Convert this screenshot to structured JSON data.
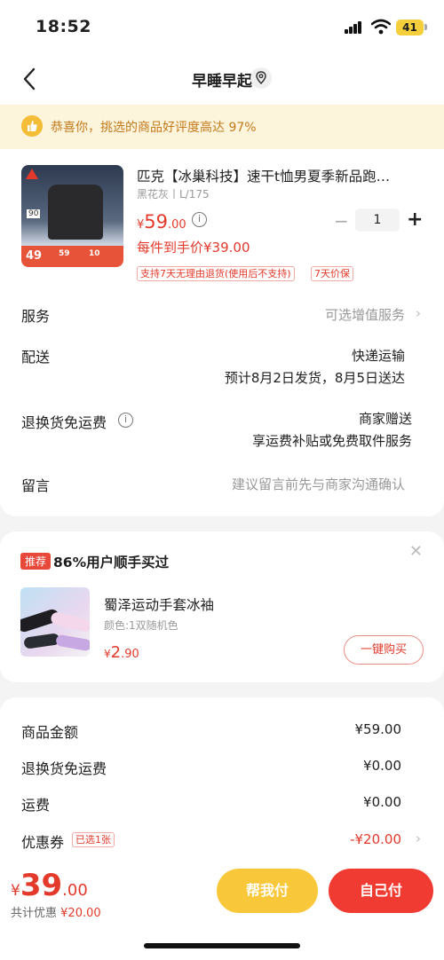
{
  "status": {
    "time": "18:52",
    "battery": "41"
  },
  "nav": {
    "title": "早睡早起"
  },
  "banner": {
    "text": "恭喜你，挑选的商品好评度高达 97%"
  },
  "product": {
    "name": "匹克【冰巢科技】速干t恤男夏季新品跑…",
    "spec": "黑花灰丨L/175",
    "price_symbol": "¥",
    "price_int": "59",
    "price_dec": ".00",
    "quantity": "1",
    "hand_price": "每件到手价¥39.00",
    "tags": [
      "支持7天无理由退货(使用后不支持)",
      "7天价保"
    ],
    "image_badges": [
      "90",
      "49",
      "59",
      "10"
    ]
  },
  "rows": {
    "service_label": "服务",
    "service_value": "可选增值服务",
    "delivery_label": "配送",
    "delivery_method": "快递运输",
    "delivery_time": "预计8月2日发货，8月5日送达",
    "return_label": "退换货免运费",
    "return_value1": "商家赠送",
    "return_value2": "享运费补贴或免费取件服务",
    "message_label": "留言",
    "message_placeholder": "建议留言前先与商家沟通确认"
  },
  "recommend": {
    "badge": "推荐",
    "title": "86%用户顺手买过",
    "item_name": "蜀泽运动手套冰袖",
    "item_spec": "颜色:1双随机色",
    "price_symbol": "¥",
    "price_int": "2",
    "price_dec": ".90",
    "button": "一键购买"
  },
  "summary": {
    "goods_label": "商品金额",
    "goods_value": "¥59.00",
    "return_label": "退换货免运费",
    "return_value": "¥0.00",
    "ship_label": "运费",
    "ship_value": "¥0.00",
    "coupon_label": "优惠券",
    "coupon_tag": "已选1张",
    "coupon_value": "-¥20.00"
  },
  "footer": {
    "total_symbol": "¥",
    "total_int": "39",
    "total_dec": ".00",
    "saved_label": "共计优惠",
    "saved_value": "¥20.00",
    "help_pay": "帮我付",
    "self_pay": "自己付"
  },
  "colors": {
    "accent": "#e33a2b",
    "banner_bg": "#fdf4dc",
    "banner_text": "#c27a1e",
    "help_btn": "#f8c83a",
    "self_btn": "#ef3b31"
  }
}
